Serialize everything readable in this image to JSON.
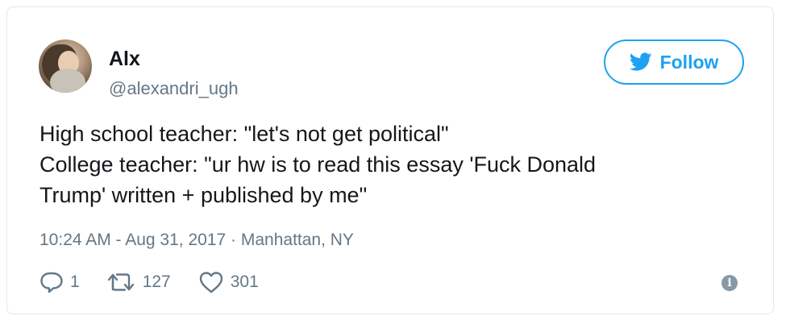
{
  "tweet": {
    "user": {
      "name": "Alx",
      "handle": "@alexandri_ugh"
    },
    "follow_label": "Follow",
    "text_lines": [
      "High school teacher: \"let's not get political\"",
      "College teacher: \"ur hw is to read this essay 'Fuck Donald",
      "Trump' written + published by me\""
    ],
    "timestamp": "10:24 AM - Aug 31, 2017",
    "separator": " · ",
    "location": "Manhattan, NY",
    "counts": {
      "replies": "1",
      "retweets": "127",
      "likes": "301"
    }
  },
  "colors": {
    "accent": "#1da1f2",
    "muted": "#657786",
    "text": "#14171a",
    "border": "#e1e8ed"
  },
  "icons": [
    "twitter-bird-icon",
    "reply-icon",
    "retweet-icon",
    "like-icon",
    "info-icon"
  ]
}
